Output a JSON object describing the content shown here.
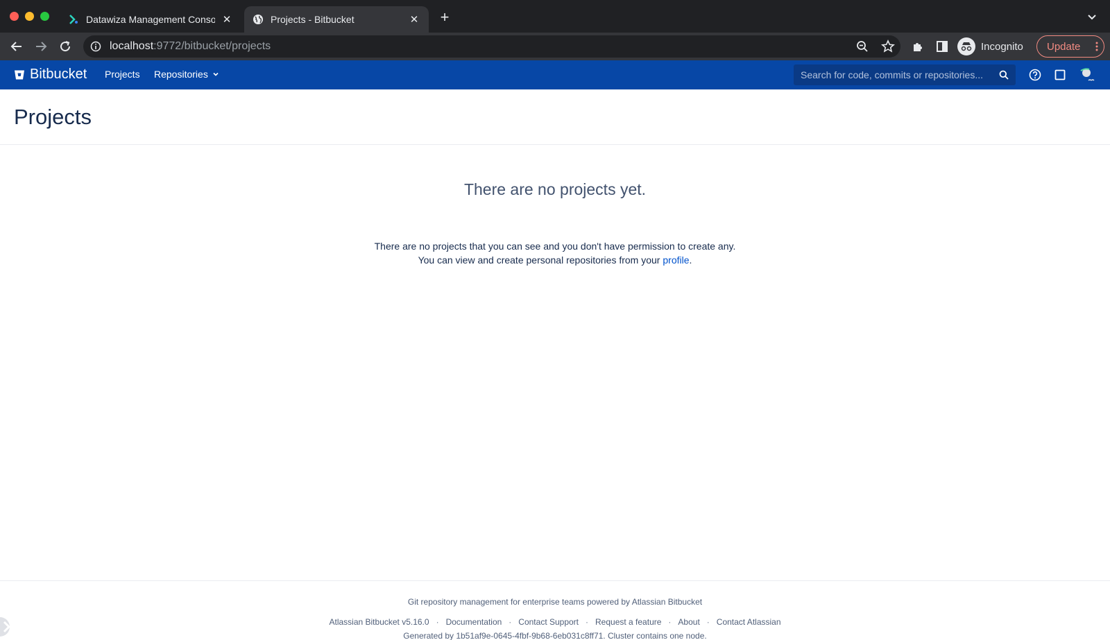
{
  "browser": {
    "tabs": [
      {
        "title": "Datawiza Management Console",
        "active": false
      },
      {
        "title": "Projects - Bitbucket",
        "active": true
      }
    ],
    "url_host": "localhost",
    "url_path": ":9772/bitbucket/projects",
    "profile_label": "Incognito",
    "update_label": "Update"
  },
  "header": {
    "logo_text": "Bitbucket",
    "nav": {
      "projects": "Projects",
      "repositories": "Repositories"
    },
    "search_placeholder": "Search for code, commits or repositories..."
  },
  "page": {
    "title": "Projects",
    "empty_title": "There are no projects yet.",
    "empty_line1": "There are no projects that you can see and you don't have permission to create any.",
    "empty_line2_prefix": "You can view and create personal repositories from your ",
    "empty_line2_link": "profile",
    "empty_line2_suffix": "."
  },
  "footer": {
    "tagline": "Git repository management for enterprise teams powered by Atlassian Bitbucket",
    "links": [
      "Atlassian Bitbucket v5.16.0",
      "Documentation",
      "Contact Support",
      "Request a feature",
      "About",
      "Contact Atlassian"
    ],
    "separator": "·",
    "generated": "Generated by 1b51af9e-0645-4fbf-9b68-6eb031c8ff71. Cluster contains one node."
  },
  "colors": {
    "header_bg": "#0747a6",
    "link": "#0052cc",
    "chrome_bg": "#202124"
  }
}
